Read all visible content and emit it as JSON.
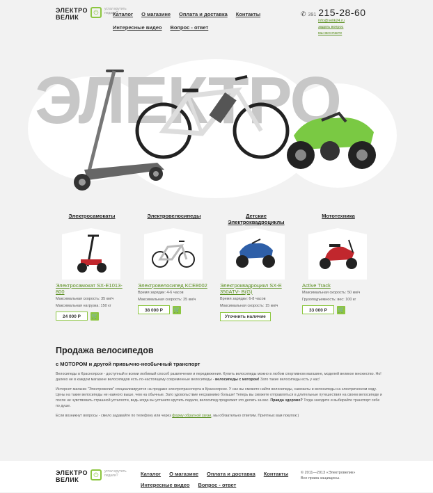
{
  "header": {
    "logo_line1": "ЭЛЕКТРО",
    "logo_line2": "ВЕЛИК",
    "logo_tagline": "устал крутить педали?",
    "nav": [
      "Каталог",
      "О магазине",
      "Оплата и доставка",
      "Контакты",
      "Интересные видео",
      "Вопрос - ответ"
    ],
    "phone_code": "391",
    "phone_number": "215-28-60",
    "email": "info@velik24.ru",
    "ask_question": "задать вопрос",
    "vk": "мы вконтакте"
  },
  "hero": {
    "word": "ЭЛЕКТРО"
  },
  "categories": [
    {
      "title": "Электросамокаты",
      "name": "Электросамокат SX-E1013-800",
      "specs": [
        "Максимальная скорость: 35 км/ч",
        "Максимальная нагрузка: 150 кг"
      ],
      "price": "24 000 Р"
    },
    {
      "title": "Электровелосипеды",
      "name": "Электровелосипед KCE8002",
      "specs": [
        "Время зарядки: 4-6 часов",
        "Максимальная скорость: 25 км/ч"
      ],
      "price": "38 000 Р"
    },
    {
      "title": "Детские Электроквадроциклы",
      "name": "Электроквадроцикл SX-E 350ATV- B(G)",
      "specs": [
        "Время зарядки: 6-8 часов",
        "Максимальная скорость: 15 км/ч"
      ],
      "button": "Уточнить наличие"
    },
    {
      "title": "Мототехника",
      "name": "Active Track",
      "specs": [
        "Максимальная скорость: 50 км/ч",
        "Грузоподъемность: вес: 100 кг"
      ],
      "price": "33 000 Р"
    }
  ],
  "article": {
    "title": "Продажа велосипедов",
    "subtitle": "с МОТОРОМ и другой привычно-необычный транспорт",
    "p1": "Велосипеды в Красноярске - доступный и всеми любимый способ развлечения и передвижения. Купить велосипеды можно в любом спортивном магазине, моделей великое множество. Но! далеко не в каждом магазине велосипедов есть по-настоящему современные велосипеды -",
    "p1_bold": "велосипеды с мотором!",
    "p1_end": "Зато такие велосипеды есть у нас!",
    "p2": "Интернет-магазин \"Электровелик\" специализируется на продаже электротранспорта в Красноярске. У нас вы сможете найти велосипеды, самокаты и велосипеды на электрическом ходу. Цены на такие велосипеды не намного выше, чем на обычные. Зато удовольствие несравнимо больше! Теперь вы сможете отправляться в длительные путешествия на своем велосипеде и после не чувствовать страшной усталости, ведь когда вы устанете крутить педали, велосипед продолжит это делать за вас.",
    "p2_bold": "Правда здорово?",
    "p2_end": "Тогда заходите и выбирайте транспорт себе по душе.",
    "p3_start": "Если возникнут вопросы - смело задавайте по телефону или через",
    "p3_link": "форму обратной связи",
    "p3_end": ", мы обязательно ответим. Приятных вам покупок:)"
  },
  "footer": {
    "nav": [
      "Каталог",
      "О магазине",
      "Оплата и доставка",
      "Контакты",
      "Интересные видео",
      "Вопрос - ответ"
    ],
    "copyright": "© 2011—2013 «Электровелик»",
    "rights": "Все права защищены."
  }
}
